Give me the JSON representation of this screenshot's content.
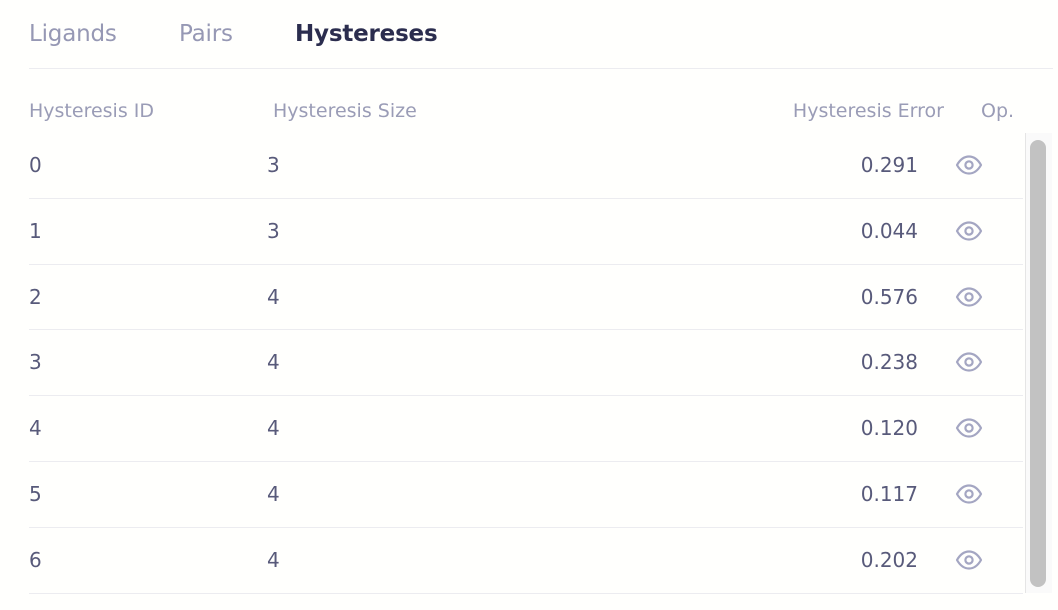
{
  "tabs": [
    {
      "label": "Ligands",
      "active": false
    },
    {
      "label": "Pairs",
      "active": false
    },
    {
      "label": "Hystereses",
      "active": true
    }
  ],
  "table": {
    "columns": [
      "Hysteresis ID",
      "Hysteresis Size",
      "Hysteresis Error",
      "Op."
    ],
    "rows": [
      {
        "id": "0",
        "size": "3",
        "error": "0.291",
        "op_icon": "eye-icon"
      },
      {
        "id": "1",
        "size": "3",
        "error": "0.044",
        "op_icon": "eye-icon"
      },
      {
        "id": "2",
        "size": "4",
        "error": "0.576",
        "op_icon": "eye-icon"
      },
      {
        "id": "3",
        "size": "4",
        "error": "0.238",
        "op_icon": "eye-icon"
      },
      {
        "id": "4",
        "size": "4",
        "error": "0.120",
        "op_icon": "eye-icon"
      },
      {
        "id": "5",
        "size": "4",
        "error": "0.117",
        "op_icon": "eye-icon"
      },
      {
        "id": "6",
        "size": "4",
        "error": "0.202",
        "op_icon": "eye-icon"
      }
    ]
  },
  "colors": {
    "active_tab": "#2b2d4e",
    "inactive_tab": "#9698b4",
    "text": "#585a7a",
    "icon": "#a4a6c2"
  }
}
